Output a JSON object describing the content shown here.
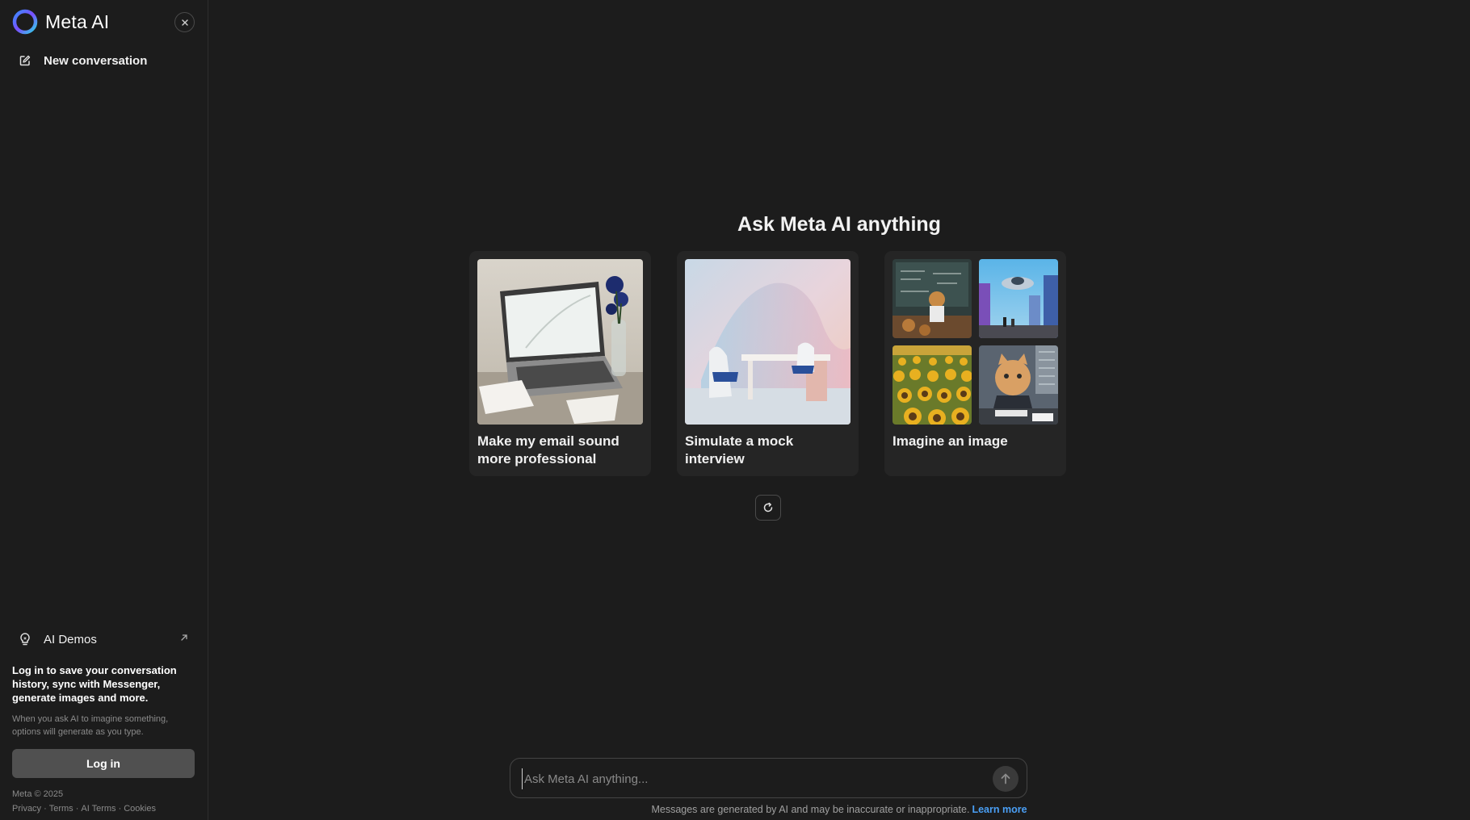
{
  "sidebar": {
    "brand_name": "Meta AI",
    "new_conversation_label": "New conversation",
    "ai_demos_label": "AI Demos",
    "login_prompt": "Log in to save your conversation history, sync with Messenger, generate images and more.",
    "login_hint": "When you ask AI to imagine something, options will generate as you type.",
    "login_button": "Log in",
    "copyright": "Meta © 2025",
    "footer_links": [
      "Privacy",
      "Terms",
      "AI Terms",
      "Cookies"
    ]
  },
  "main": {
    "headline": "Ask Meta AI anything",
    "cards": [
      {
        "title": "Make my email sound more professional"
      },
      {
        "title": "Simulate a mock interview"
      },
      {
        "title": "Imagine an image"
      }
    ],
    "input_placeholder": "Ask Meta AI anything...",
    "disclaimer": "Messages are generated by AI and may be inaccurate or inappropriate.",
    "learn_more": "Learn more"
  },
  "icons": {
    "close": "close-icon",
    "new_conversation": "edit-icon",
    "ai_demos": "lightbulb-icon",
    "external": "external-link-icon",
    "refresh": "refresh-icon",
    "send": "arrow-up-icon"
  },
  "colors": {
    "background": "#1c1c1c",
    "card": "#252525",
    "link": "#4a9ff5",
    "login_button": "#505050"
  }
}
